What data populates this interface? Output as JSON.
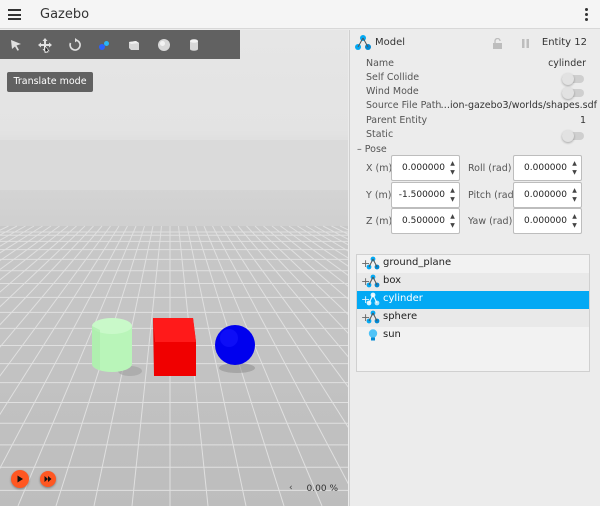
{
  "app": {
    "title": "Gazebo"
  },
  "toolbar": {
    "tools": [
      {
        "name": "select-tool",
        "icon": "arrow-pointer-icon"
      },
      {
        "name": "translate-tool",
        "icon": "move-arrows-icon"
      },
      {
        "name": "rotate-tool",
        "icon": "rotate-icon"
      },
      {
        "name": "transform-control-tool",
        "icon": "transform-control-icon"
      },
      {
        "name": "box-tool",
        "icon": "box-icon"
      },
      {
        "name": "sphere-tool",
        "icon": "sphere-icon"
      },
      {
        "name": "cylinder-tool",
        "icon": "cylinder-icon"
      }
    ],
    "tooltip": "Translate mode"
  },
  "playback": {
    "real_time_factor": "0.00 %",
    "chevron": "‹"
  },
  "component_inspector": {
    "title": "Model",
    "entity": "Entity 12",
    "properties": [
      {
        "label": "Name",
        "value": "cylinder"
      },
      {
        "label": "Self Collide",
        "toggle": false
      },
      {
        "label": "Wind Mode",
        "toggle": false
      },
      {
        "label": "Source File Path",
        "value": "…ion-gazebo3/worlds/shapes.sdf"
      },
      {
        "label": "Parent Entity",
        "value": "1"
      },
      {
        "label": "Static",
        "toggle": false
      }
    ],
    "pose": {
      "header": "Pose",
      "collapse_symbol": "–",
      "fields": [
        {
          "label": "X (m)",
          "value": "0.000000"
        },
        {
          "label": "Roll (rad)",
          "value": "0.000000"
        },
        {
          "label": "Y (m)",
          "value": "-1.500000"
        },
        {
          "label": "Pitch (rad)",
          "value": "0.000000"
        },
        {
          "label": "Z (m)",
          "value": "0.500000"
        },
        {
          "label": "Yaw (rad)",
          "value": "0.000000"
        }
      ]
    }
  },
  "entity_tree": {
    "items": [
      {
        "label": "ground_plane",
        "expander": "+",
        "icon": "model-icon",
        "selected": false
      },
      {
        "label": "box",
        "expander": "+",
        "icon": "model-icon",
        "selected": false
      },
      {
        "label": "cylinder",
        "expander": "+",
        "icon": "model-icon",
        "selected": true
      },
      {
        "label": "sphere",
        "expander": "+",
        "icon": "model-icon",
        "selected": false
      },
      {
        "label": "sun",
        "expander": "",
        "icon": "light-bulb-icon",
        "selected": false
      }
    ]
  },
  "colors": {
    "accent": "#03a9f4",
    "play_button": "#ff5722",
    "toolbar": "#616161",
    "cylinder": "#b9f5b9",
    "box": "#ff0000",
    "sphere": "#0000ee"
  }
}
